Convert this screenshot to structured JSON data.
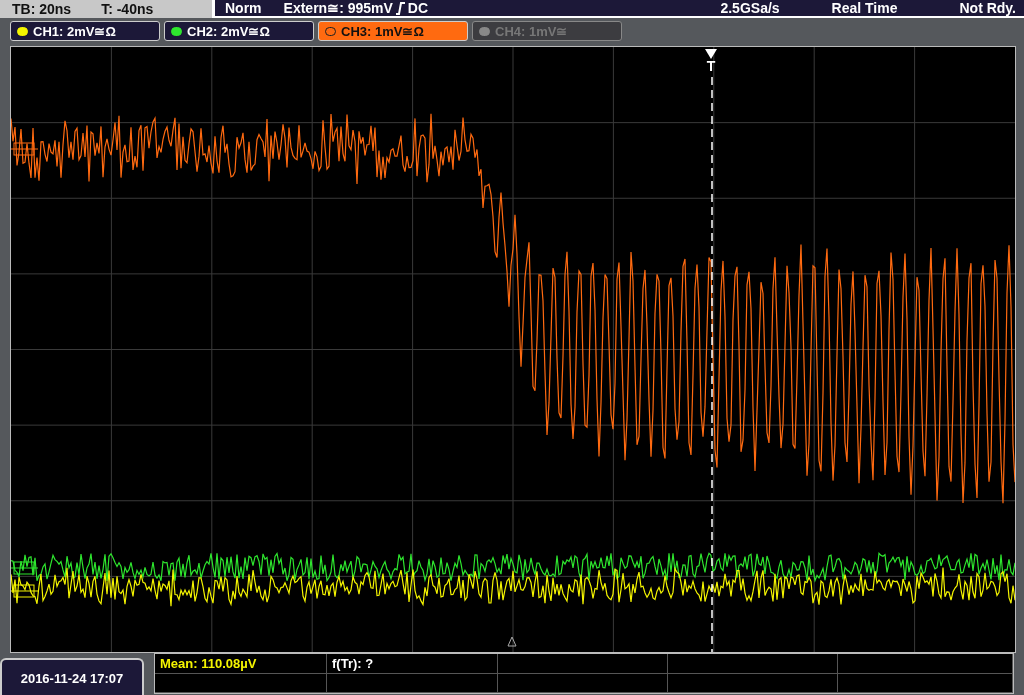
{
  "timebase": {
    "scale": "TB: 20ns",
    "offset": "T: -40ns"
  },
  "status": {
    "mode": "Norm",
    "trigger_source": "Extern≅: 995mV",
    "trigger_coupling": "DC",
    "sample_rate": "2.5GSa/s",
    "acquisition": "Real Time",
    "state": "Not Rdy."
  },
  "channels": [
    {
      "label": "CH1: 2mV≅Ω",
      "color": "#f4f400",
      "selected": false,
      "on": true
    },
    {
      "label": "CH2: 2mV≅Ω",
      "color": "#2ee62e",
      "selected": false,
      "on": true
    },
    {
      "label": "CH3: 1mV≅Ω",
      "color": "#ff6a10",
      "selected": true,
      "on": true
    },
    {
      "label": "CH4: 1mV≅",
      "color": "#888888",
      "selected": false,
      "on": false
    }
  ],
  "trigger_marker": {
    "label": "T"
  },
  "date_time": "2016-11-24 17:07",
  "measurements": [
    {
      "text": "Mean: 110.08µV",
      "color": "#f4f400"
    },
    {
      "text": "f(Tr): ?",
      "color": "#ffffff"
    }
  ]
}
